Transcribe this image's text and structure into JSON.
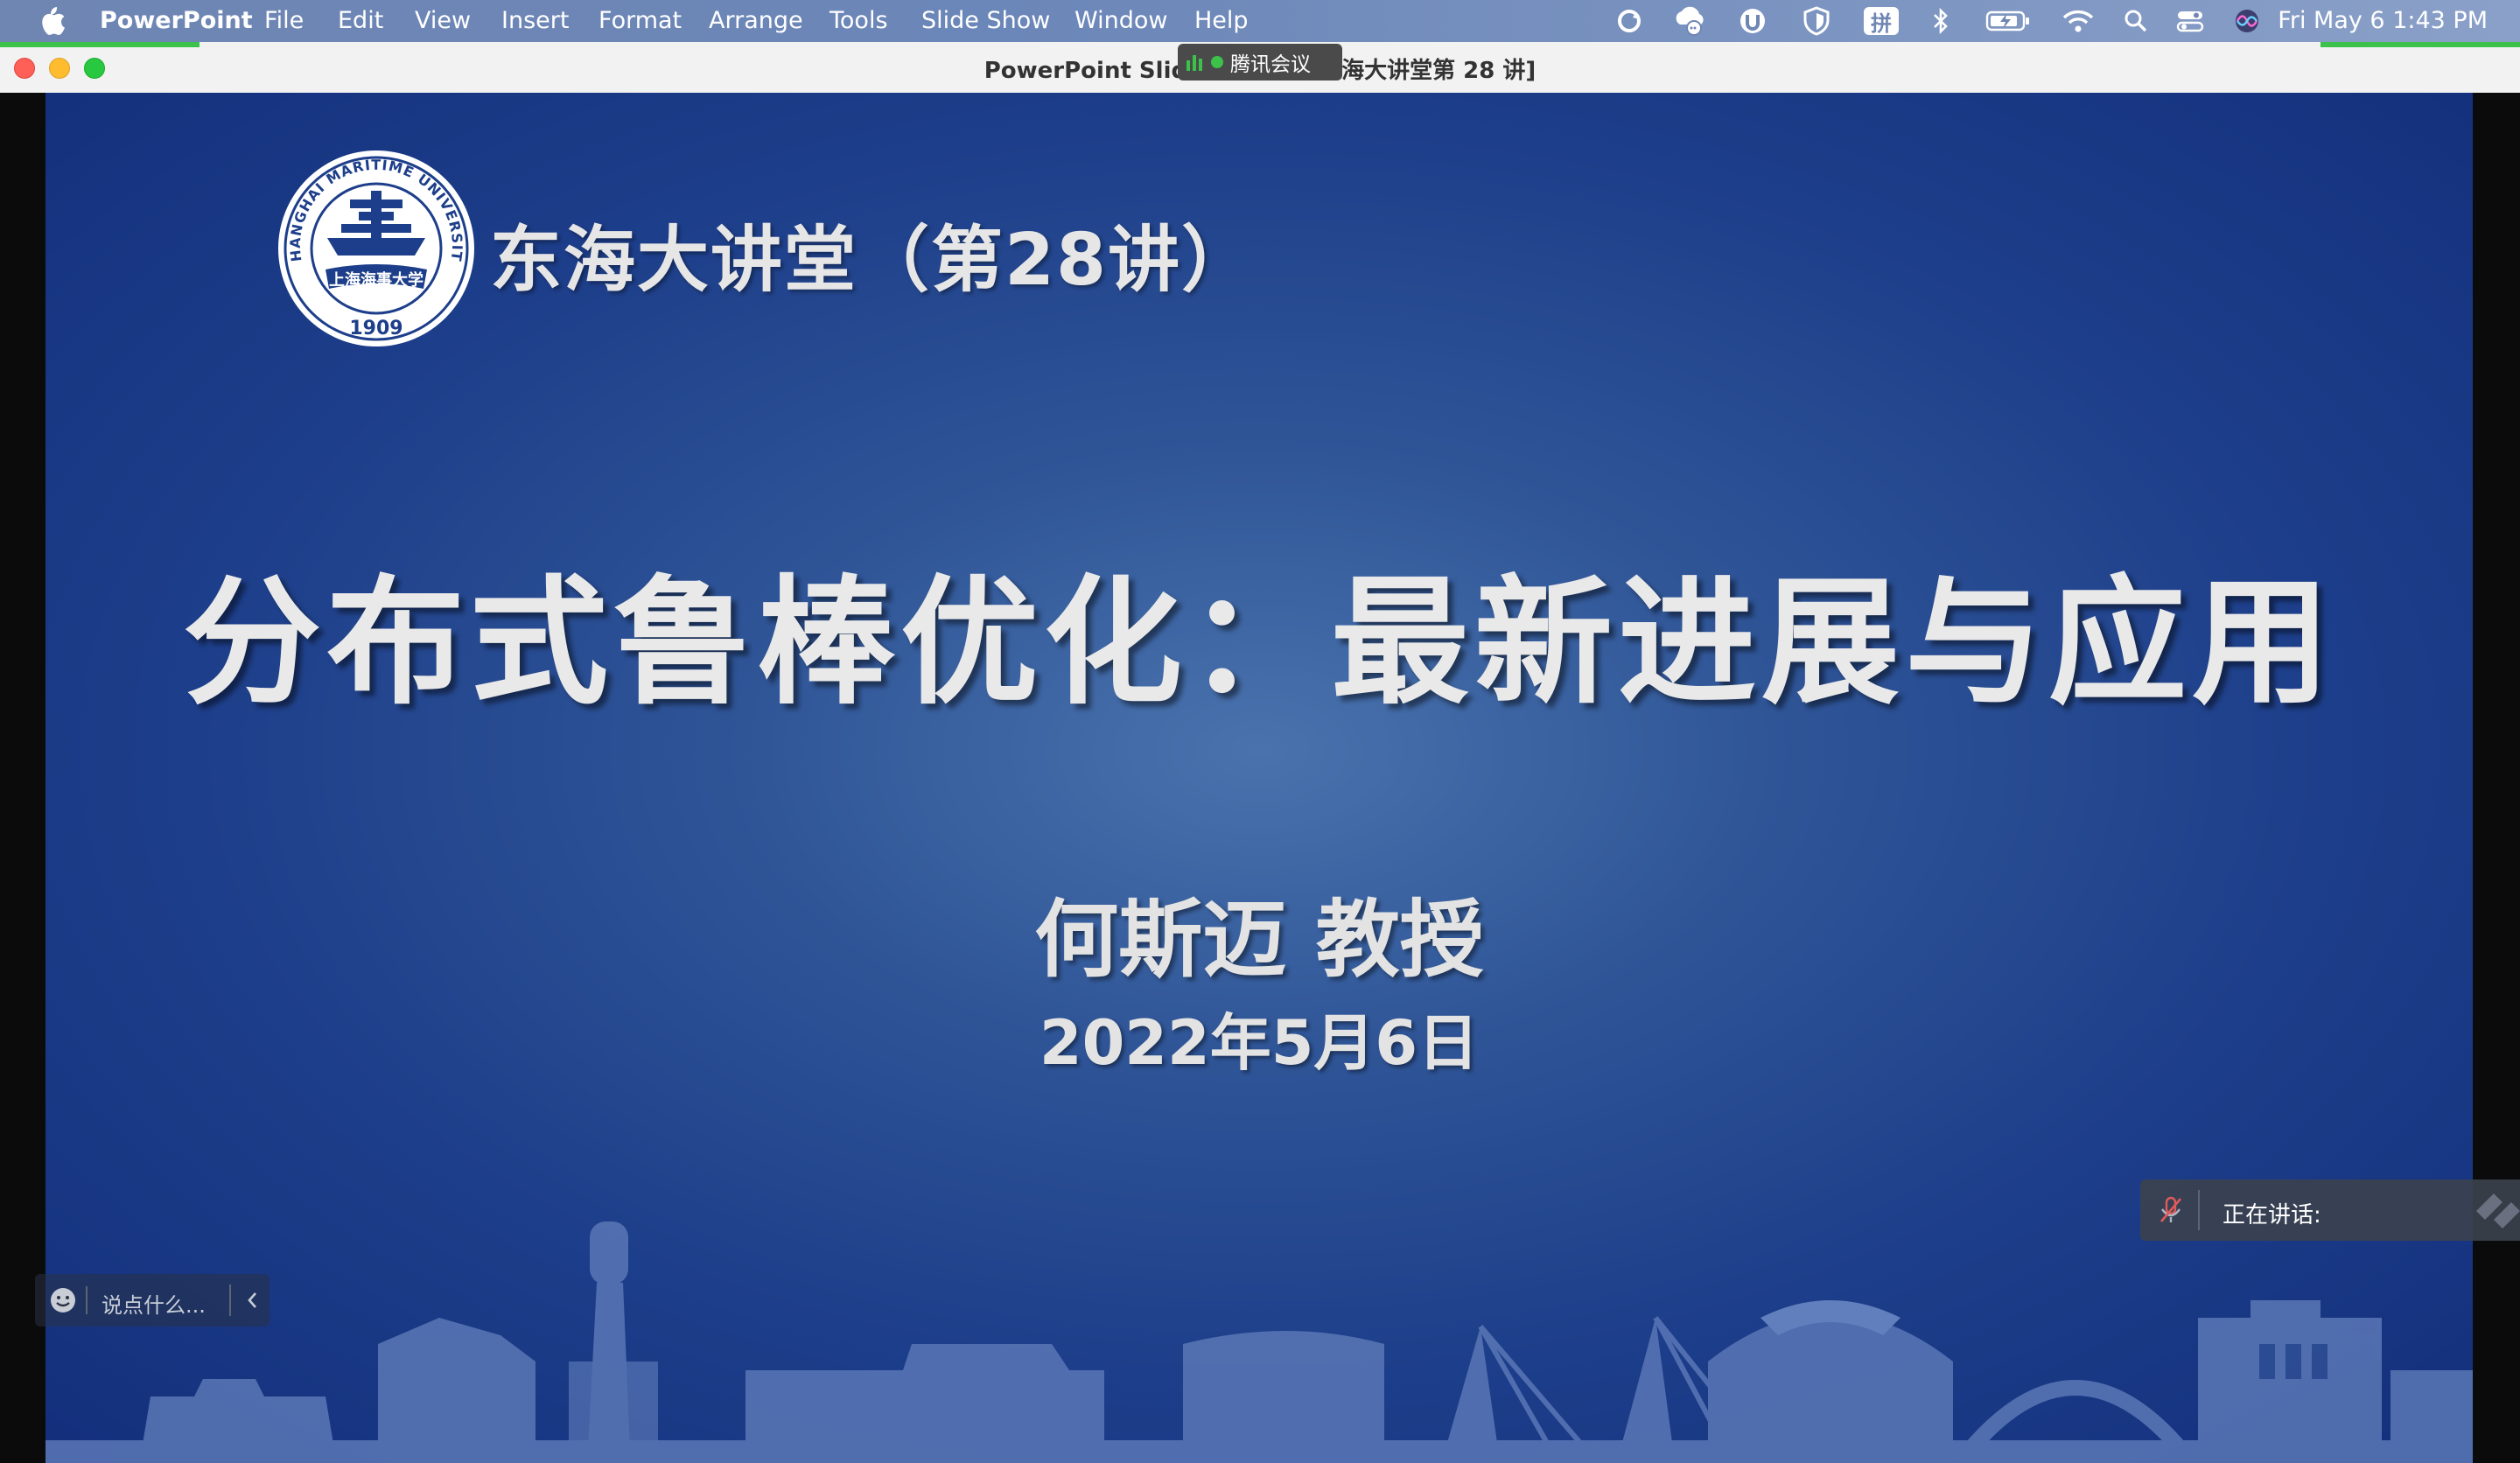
{
  "menubar": {
    "app_name": "PowerPoint",
    "menus": [
      "File",
      "Edit",
      "View",
      "Insert",
      "Format",
      "Arrange",
      "Tools",
      "Slide Show",
      "Window",
      "Help"
    ],
    "status_icons": [
      "sync-icon",
      "cloud-chat-icon",
      "timer-icon",
      "shield-icon",
      "pinyin-input-icon",
      "bluetooth-icon",
      "battery-icon",
      "wifi-icon",
      "search-icon",
      "control-center-icon",
      "siri-icon"
    ],
    "input_method_label": "拼",
    "datetime": "Fri May 6  1:43 PM"
  },
  "window": {
    "title_left": "PowerPoint Slid",
    "title_right": "海大讲堂第 28 讲]",
    "meeting_app": "腾讯会议"
  },
  "slide": {
    "series_title": "东海大讲堂（第28讲）",
    "logo": {
      "ring_text": "SHANGHAI MARITIME UNIVERSITY",
      "inner_text": "上海海事大学",
      "year": "1909"
    },
    "main_title": "分布式鲁棒优化：最新进展与应用",
    "presenter": "何斯迈 教授",
    "date": "2022年5月6日"
  },
  "chat": {
    "placeholder": "说点什么..."
  },
  "speaking": {
    "label": "正在讲话:"
  },
  "colors": {
    "slide_dark": "#132f7c",
    "slide_light": "#4a73ad",
    "skyline": "#5a77b6",
    "menubar": "#6f86b3",
    "traffic_red": "#fe5f57",
    "traffic_yellow": "#febc2e",
    "traffic_green": "#28c840"
  }
}
